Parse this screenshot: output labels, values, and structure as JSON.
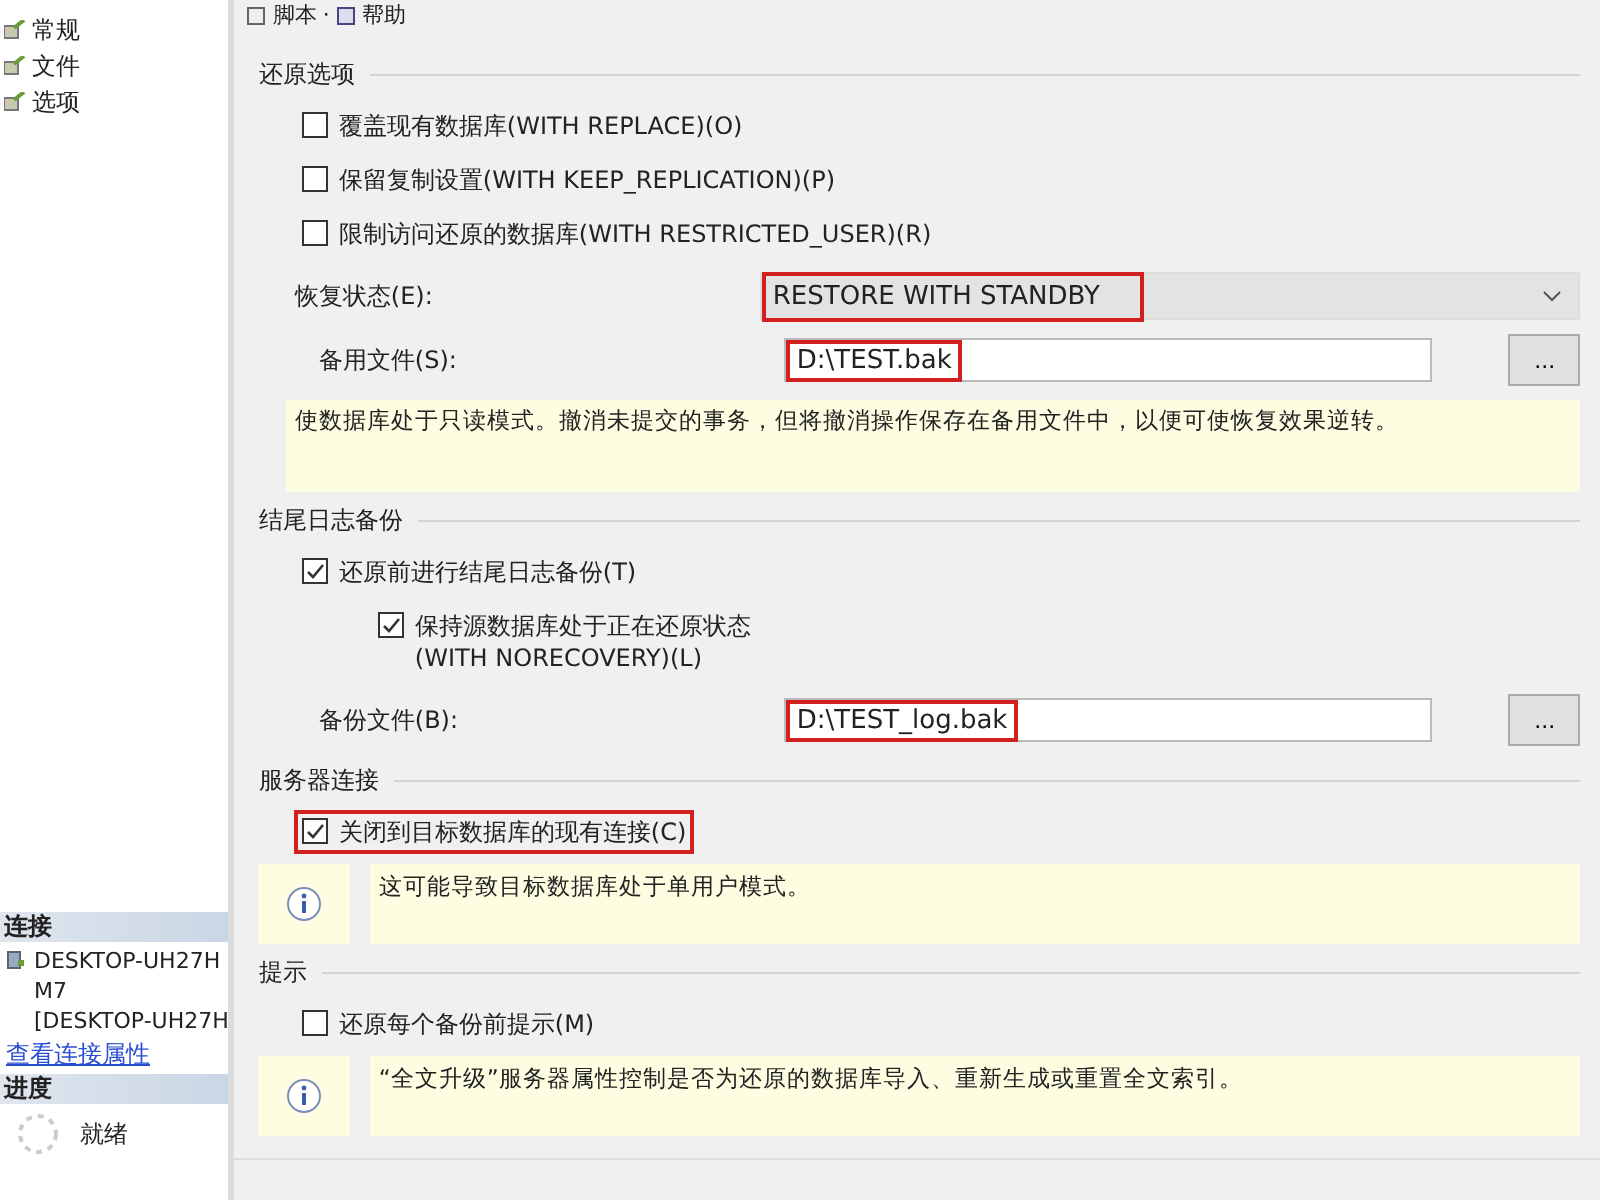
{
  "sidebar": {
    "pages": [
      "常规",
      "文件",
      "选项"
    ],
    "connection": {
      "title": "连接",
      "server_lines": [
        "DESKTOP-UH27H",
        "M7",
        "[DESKTOP-UH27H"
      ],
      "link": "查看连接属性"
    },
    "progress": {
      "title": "进度",
      "status": "就绪"
    }
  },
  "toolbar": {
    "items": [
      "脚本",
      "帮助"
    ],
    "separator": "·"
  },
  "sections": [
    {
      "title": "还原选项",
      "items": [
        {
          "kind": "checkbox",
          "label": "覆盖现有数据库(WITH REPLACE)(O)",
          "checked": false,
          "highlighted": false,
          "indent": false
        },
        {
          "kind": "checkbox",
          "label": "保留复制设置(WITH KEEP_REPLICATION)(P)",
          "checked": false,
          "highlighted": false,
          "indent": false
        },
        {
          "kind": "checkbox",
          "label": "限制访问还原的数据库(WITH RESTRICTED_USER)(R)",
          "checked": false,
          "highlighted": false,
          "indent": false
        },
        {
          "kind": "combo",
          "label": "恢复状态(E):",
          "value": "RESTORE WITH STANDBY",
          "highlighted": true
        },
        {
          "kind": "file",
          "label": "备用文件(S):",
          "value": "D:\\TEST.bak",
          "button": "...",
          "highlighted": true
        },
        {
          "kind": "note",
          "text": "使数据库处于只读模式。撤消未提交的事务，但将撤消操作保存在备用文件中，以便可使恢复效果逆转。"
        }
      ]
    },
    {
      "title": "结尾日志备份",
      "items": [
        {
          "kind": "checkbox",
          "label": "还原前进行结尾日志备份(T)",
          "checked": true,
          "highlighted": false,
          "indent": false
        },
        {
          "kind": "checkbox",
          "label": "保持源数据库处于正在还原状态\n(WITH NORECOVERY)(L)",
          "checked": true,
          "highlighted": false,
          "indent": true
        },
        {
          "kind": "file",
          "label": "备份文件(B):",
          "value": "D:\\TEST_log.bak",
          "button": "...",
          "highlighted": true
        }
      ]
    },
    {
      "title": "服务器连接",
      "items": [
        {
          "kind": "checkbox",
          "label": "关闭到目标数据库的现有连接(C)",
          "checked": true,
          "highlighted": true,
          "indent": false
        },
        {
          "kind": "info",
          "text": "这可能导致目标数据库处于单用户模式。"
        }
      ]
    },
    {
      "title": "提示",
      "items": [
        {
          "kind": "checkbox",
          "label": "还原每个备份前提示(M)",
          "checked": false,
          "highlighted": false,
          "indent": false
        },
        {
          "kind": "info",
          "text": "“全文升级”服务器属性控制是否为还原的数据库导入、重新生成或重置全文索引。"
        }
      ]
    }
  ]
}
